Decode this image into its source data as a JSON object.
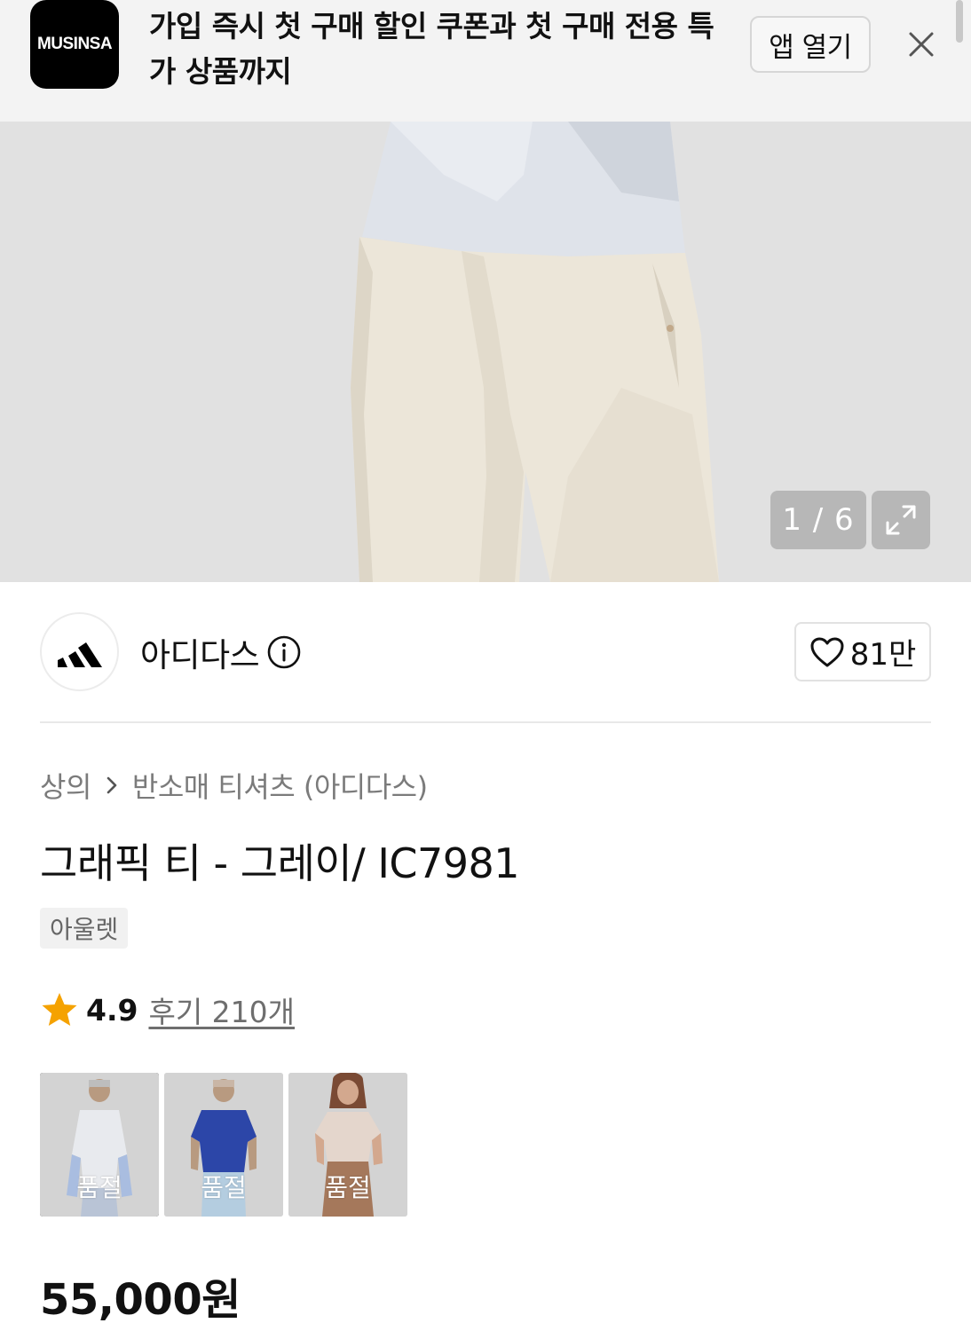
{
  "banner": {
    "logo_text": "MUSINSA",
    "message": "가입 즉시 첫 구매 할인 쿠폰과 첫 구매 전용 특가 상품까지",
    "open_app_label": "앱 열기",
    "close_icon": "close-icon"
  },
  "gallery": {
    "counter": "1 / 6",
    "expand_icon": "expand-icon"
  },
  "brand": {
    "name": "아디다스",
    "logo_icon": "adidas-logo",
    "info_icon": "info-icon",
    "likes": "81만",
    "like_icon": "heart-icon"
  },
  "product": {
    "breadcrumb": [
      "상의",
      "반소매 티셔츠 (아디다스)"
    ],
    "title": "그래픽 티 - 그레이/ IC7981",
    "badge": "아울렛",
    "rating": "4.9",
    "reviews": "후기 210개",
    "color_options": [
      {
        "label": "품절",
        "selected": true
      },
      {
        "label": "품절",
        "selected": false
      },
      {
        "label": "품절",
        "selected": false
      }
    ],
    "price": "55,000원"
  },
  "colors": {
    "star": "#f5a200",
    "banner_bg": "#f3f3f3"
  }
}
